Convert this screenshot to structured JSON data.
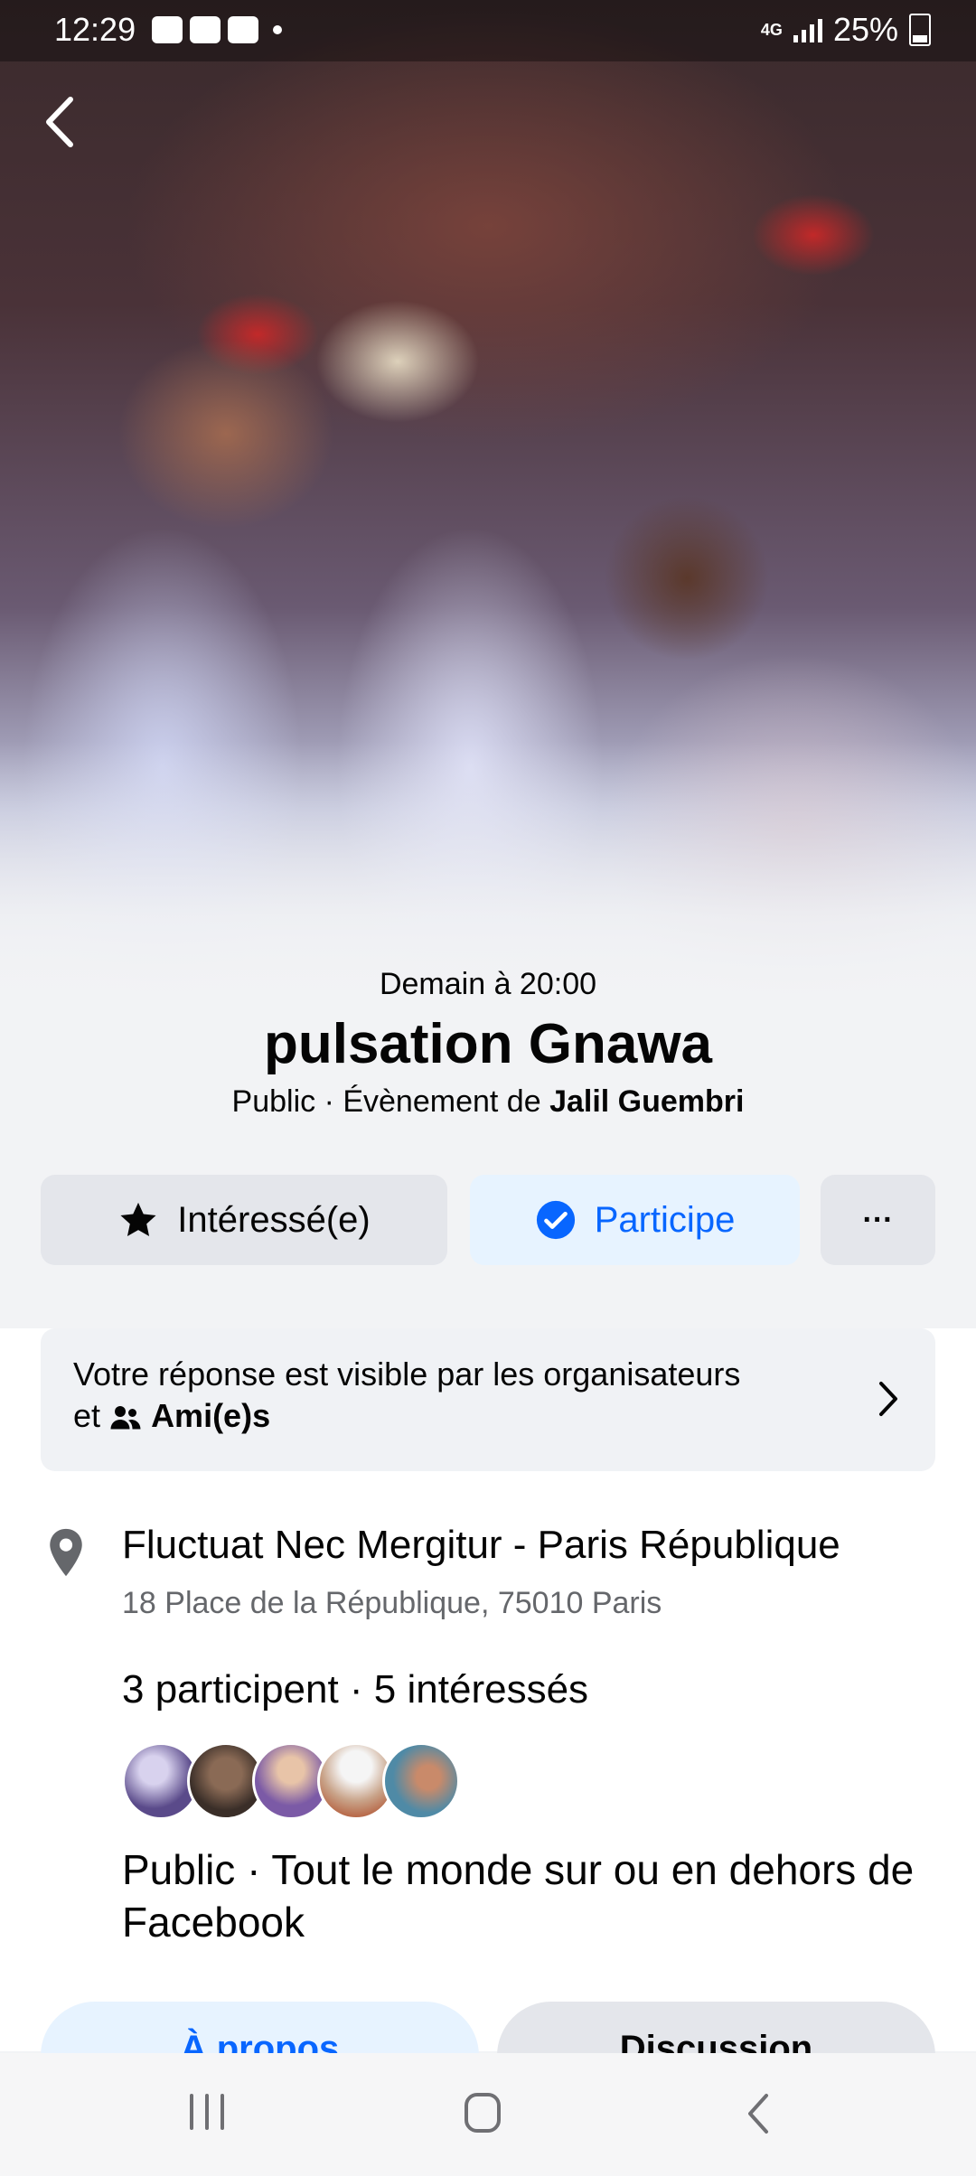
{
  "status_bar": {
    "time": "12:29",
    "network": "4G",
    "battery": "25%"
  },
  "event": {
    "date": "Demain à 20:00",
    "title": "pulsation Gnawa",
    "subtitle_prefix": "Public · Évènement de ",
    "organizer": "Jalil Guembri"
  },
  "actions": {
    "interested_label": "Intéressé(e)",
    "participate_label": "Participe",
    "more_label": "···"
  },
  "notice": {
    "text": "Votre réponse est visible par les organisateurs",
    "prefix": "et",
    "audience": "Ami(e)s"
  },
  "location": {
    "venue": "Fluctuat Nec Mergitur - Paris République",
    "address": "18 Place de la République, 75010 Paris"
  },
  "attendance": {
    "counts": "3 participent · 5 intéressés",
    "avatar_colors": [
      "#5a4a8a",
      "#3a2e28",
      "#7b5aa6",
      "#c9a48a",
      "#4f8aa6"
    ]
  },
  "privacy": "Public · Tout le monde sur ou en dehors de Facebook",
  "tabs": {
    "about": "À propos",
    "discussion": "Discussion"
  },
  "colors": {
    "accent": "#0866ff",
    "accent_bg": "#e7f3ff",
    "button_bg": "#e4e6eb"
  }
}
